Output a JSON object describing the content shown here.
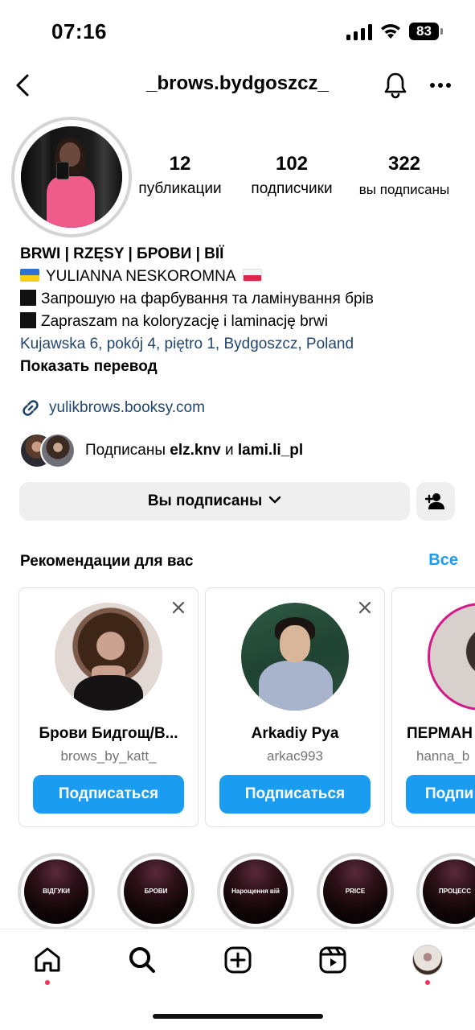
{
  "status_bar": {
    "time": "07:16",
    "battery": "83"
  },
  "header": {
    "username": "_brows.bydgoszcz_"
  },
  "profile": {
    "stats": {
      "posts": {
        "value": "12",
        "label": "публикации"
      },
      "followers": {
        "value": "102",
        "label": "подписчики"
      },
      "following": {
        "value": "322",
        "label": "вы подписаны"
      }
    },
    "bio": {
      "name_line": "BRWI | RZĘSY | БРОВИ | ВІЇ",
      "owner": "YULIANNA NESKOROMNA",
      "line_ua": "Запрошую на фарбування та ламінування брів",
      "line_pl": "Zapraszam na koloryzację i laminację brwi",
      "address": "Kujawska 6, pokój 4, piętro 1, Bydgoszcz, Poland",
      "translate": "Показать перевод"
    },
    "link": "yulikbrows.booksy.com",
    "followed_by": {
      "prefix": "Подписаны",
      "user1": "elz.knv",
      "conj": "и",
      "user2": "lami.li_pl"
    },
    "following_button": "Вы подписаны"
  },
  "recommendations": {
    "title": "Рекомендации для вас",
    "see_all": "Все",
    "cards": [
      {
        "name": "Брови Бидгощ/В...",
        "handle": "brows_by_katt_",
        "button": "Подписаться"
      },
      {
        "name": "Arkadiy Pya",
        "handle": "arkac993",
        "button": "Подписаться"
      },
      {
        "name": "ПЕРМАН",
        "handle": "hanna_b",
        "button": "Подпи"
      }
    ]
  },
  "highlights": [
    {
      "label": "ВІДГУКИ"
    },
    {
      "label": "БРОВИ"
    },
    {
      "label": "Нарощення вій"
    },
    {
      "label": "PRICE"
    },
    {
      "label": "ПРОЦЕСС"
    }
  ],
  "icons": {
    "back": "chevron-left-icon",
    "bell": "bell-icon",
    "more": "more-horizontal-icon",
    "link": "link-icon",
    "add_person": "person-add-icon",
    "close": "close-icon",
    "home": "home-icon",
    "search": "search-icon",
    "create": "plus-square-icon",
    "reels": "reels-icon"
  },
  "colors": {
    "accent": "#1a9cf0",
    "link": "#21466d",
    "notification_dot": "#ff2d55"
  }
}
